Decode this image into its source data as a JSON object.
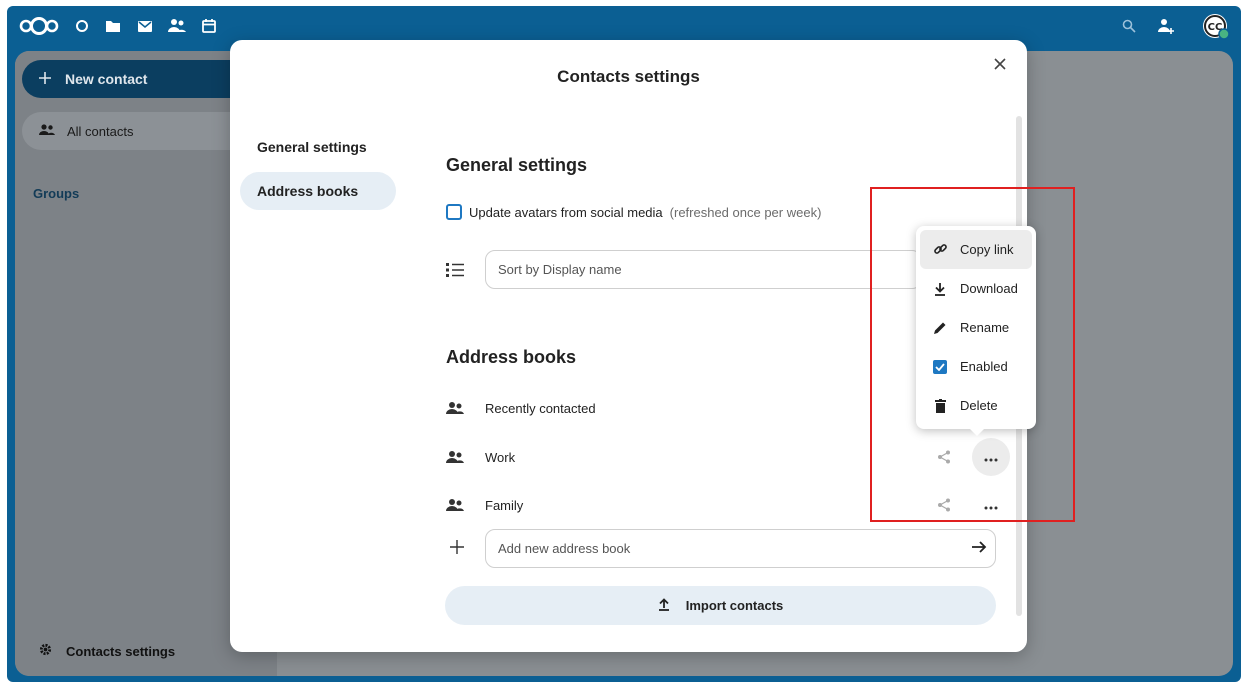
{
  "nav": {
    "new_contact": "New contact",
    "all_contacts": "All contacts",
    "groups_caption": "Groups",
    "contacts_settings": "Contacts settings"
  },
  "topbar": {
    "avatar_initials": "CC",
    "colors": {
      "background": "#0b5f93",
      "status": "#49b382"
    }
  },
  "modal": {
    "title": "Contacts settings",
    "nav": [
      {
        "label": "General settings"
      },
      {
        "label": "Address books"
      }
    ],
    "general": {
      "heading": "General settings",
      "avatar_option": "Update avatars from social media",
      "avatar_option_hint": "(refreshed once per week)",
      "avatar_checked": false,
      "sort_value": "Sort by Display name"
    },
    "address_books": {
      "heading": "Address books",
      "items": [
        {
          "label": "Recently contacted"
        },
        {
          "label": "Work"
        },
        {
          "label": "Family"
        }
      ],
      "add_placeholder": "Add new address book",
      "import_label": "Import contacts"
    }
  },
  "menu": {
    "items": [
      {
        "label": "Copy link",
        "icon": "link-icon"
      },
      {
        "label": "Download",
        "icon": "download-icon"
      },
      {
        "label": "Rename",
        "icon": "pencil-icon"
      },
      {
        "label": "Enabled",
        "icon": "checkbox-checked-icon",
        "checked": true
      },
      {
        "label": "Delete",
        "icon": "trash-icon"
      }
    ]
  },
  "colors": {
    "accent": "#1e78c2",
    "highlight": "#e02020"
  }
}
